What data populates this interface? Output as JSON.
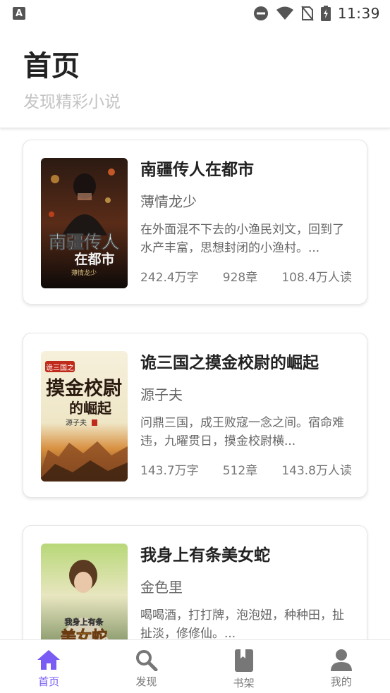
{
  "status_bar": {
    "app_icon_letter": "A",
    "time": "11:39"
  },
  "header": {
    "title": "首页",
    "subtitle": "发现精彩小说"
  },
  "books": [
    {
      "title": "南疆传人在都市",
      "author": "薄情龙少",
      "description": "在外面混不下去的小渔民刘文，回到了水产丰富，思想封闭的小渔村。...",
      "words": "242.4万字",
      "chapters": "928章",
      "readers": "108.4万人读",
      "cover_title": "南疆传人",
      "cover_subtitle": "在都市",
      "cover_author": "薄情龙少"
    },
    {
      "title": "诡三国之摸金校尉的崛起",
      "author": "源子夫",
      "description": "问鼎三国，成王败寇一念之间。宿命难违，九曜贯日，摸金校尉横...",
      "words": "143.7万字",
      "chapters": "512章",
      "readers": "143.8万人读",
      "cover_title": "摸金校尉",
      "cover_subtitle": "的崛起",
      "cover_author": "源子夫",
      "cover_tag": "诡三国之"
    },
    {
      "title": "我身上有条美女蛇",
      "author": "金色里",
      "description": "喝喝酒，打打牌，泡泡妞，种种田，扯扯淡，修修仙。...",
      "words": "",
      "chapters": "",
      "readers": "",
      "cover_title": "我身上有条",
      "cover_subtitle": "美女蛇"
    }
  ],
  "bottom_nav": [
    {
      "label": "首页",
      "icon": "home-icon",
      "active": true
    },
    {
      "label": "发现",
      "icon": "search-icon",
      "active": false
    },
    {
      "label": "书架",
      "icon": "bookshelf-icon",
      "active": false
    },
    {
      "label": "我的",
      "icon": "profile-icon",
      "active": false
    }
  ],
  "colors": {
    "accent": "#7a5cf5",
    "inactive": "#777777"
  }
}
